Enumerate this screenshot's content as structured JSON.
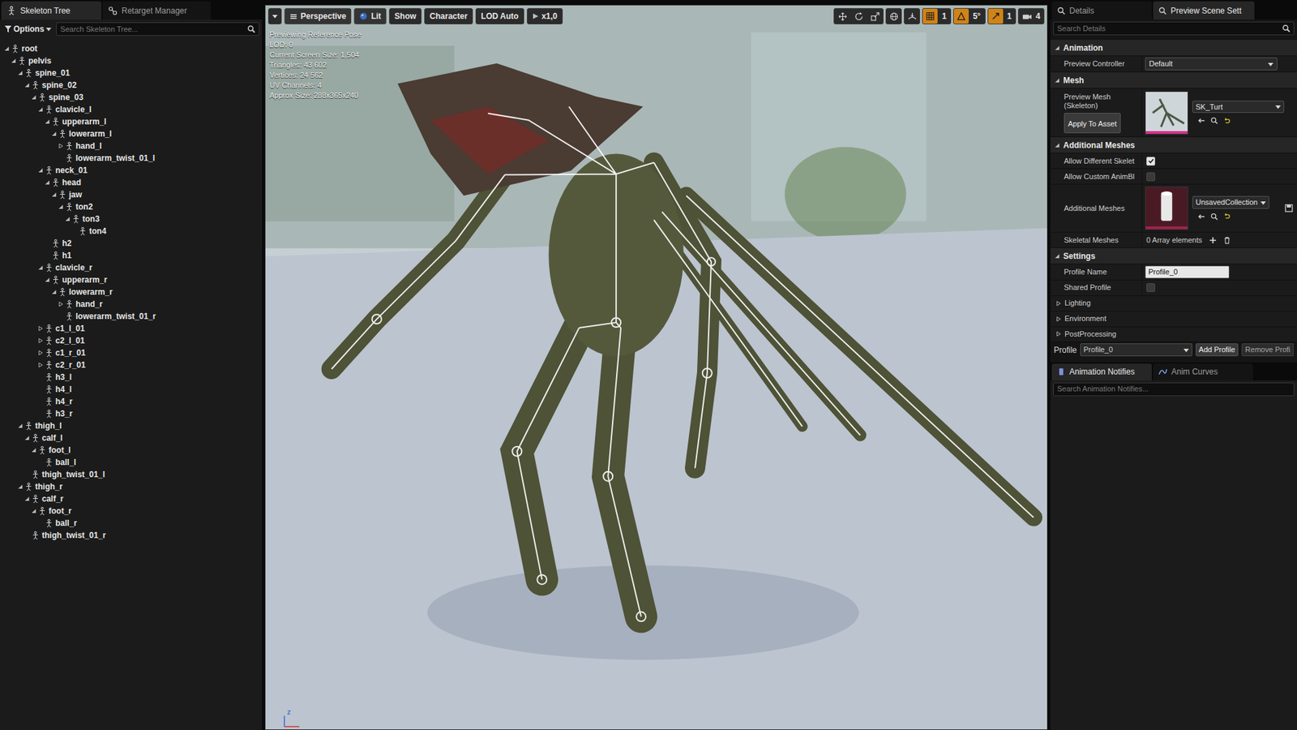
{
  "left_panel": {
    "tabs": [
      {
        "label": "Skeleton Tree",
        "selected": true
      },
      {
        "label": "Retarget Manager",
        "selected": false
      }
    ],
    "options": "Options",
    "search": {
      "placeholder": "Search Skeleton Tree..."
    },
    "tree": [
      {
        "label": "root",
        "kind": "branch",
        "expanded": true,
        "children": [
          {
            "label": "pelvis",
            "kind": "branch",
            "expanded": true,
            "children": [
              {
                "label": "spine_01",
                "kind": "branch",
                "expanded": true,
                "children": [
                  {
                    "label": "spine_02",
                    "kind": "branch",
                    "expanded": true,
                    "children": [
                      {
                        "label": "spine_03",
                        "kind": "branch",
                        "expanded": true,
                        "children": [
                          {
                            "label": "clavicle_l",
                            "kind": "branch",
                            "expanded": true,
                            "children": [
                              {
                                "label": "upperarm_l",
                                "kind": "branch",
                                "expanded": true,
                                "children": [
                                  {
                                    "label": "lowerarm_l",
                                    "kind": "branch",
                                    "expanded": true,
                                    "children": [
                                      {
                                        "label": "hand_l",
                                        "kind": "branch",
                                        "expanded": false
                                      },
                                      {
                                        "label": "lowerarm_twist_01_l",
                                        "kind": "leaf",
                                        "expanded": false
                                      }
                                    ]
                                  }
                                ]
                              }
                            ]
                          },
                          {
                            "label": "neck_01",
                            "kind": "branch",
                            "expanded": true,
                            "children": [
                              {
                                "label": "head",
                                "kind": "branch",
                                "expanded": true,
                                "children": [
                                  {
                                    "label": "jaw",
                                    "kind": "branch",
                                    "expanded": true,
                                    "children": [
                                      {
                                        "label": "ton2",
                                        "kind": "branch",
                                        "expanded": true,
                                        "children": [
                                          {
                                            "label": "ton3",
                                            "kind": "branch",
                                            "expanded": true,
                                            "children": [
                                              {
                                                "label": "ton4",
                                                "kind": "leaf",
                                                "expanded": false
                                              }
                                            ]
                                          }
                                        ]
                                      }
                                    ]
                                  }
                                ]
                              },
                              {
                                "label": "h2",
                                "kind": "leaf",
                                "expanded": false
                              },
                              {
                                "label": "h1",
                                "kind": "leaf",
                                "expanded": false
                              }
                            ]
                          },
                          {
                            "label": "clavicle_r",
                            "kind": "branch",
                            "expanded": true,
                            "children": [
                              {
                                "label": "upperarm_r",
                                "kind": "branch",
                                "expanded": true,
                                "children": [
                                  {
                                    "label": "lowerarm_r",
                                    "kind": "branch",
                                    "expanded": true,
                                    "children": [
                                      {
                                        "label": "hand_r",
                                        "kind": "branch",
                                        "expanded": false
                                      },
                                      {
                                        "label": "lowerarm_twist_01_r",
                                        "kind": "leaf",
                                        "expanded": false
                                      }
                                    ]
                                  }
                                ]
                              }
                            ]
                          },
                          {
                            "label": "c1_l_01",
                            "kind": "branch",
                            "expanded": false
                          },
                          {
                            "label": "c2_l_01",
                            "kind": "branch",
                            "expanded": false
                          },
                          {
                            "label": "c1_r_01",
                            "kind": "branch",
                            "expanded": false
                          },
                          {
                            "label": "c2_r_01",
                            "kind": "branch",
                            "expanded": false
                          },
                          {
                            "label": "h3_l",
                            "kind": "leaf",
                            "expanded": false
                          },
                          {
                            "label": "h4_l",
                            "kind": "leaf",
                            "expanded": false
                          },
                          {
                            "label": "h4_r",
                            "kind": "leaf",
                            "expanded": false
                          },
                          {
                            "label": "h3_r",
                            "kind": "leaf",
                            "expanded": false
                          }
                        ]
                      }
                    ]
                  }
                ]
              },
              {
                "label": "thigh_l",
                "kind": "branch",
                "expanded": true,
                "children": [
                  {
                    "label": "calf_l",
                    "kind": "branch",
                    "expanded": true,
                    "children": [
                      {
                        "label": "foot_l",
                        "kind": "branch",
                        "expanded": true,
                        "children": [
                          {
                            "label": "ball_l",
                            "kind": "leaf",
                            "expanded": false
                          }
                        ]
                      }
                    ]
                  },
                  {
                    "label": "thigh_twist_01_l",
                    "kind": "leaf",
                    "expanded": false
                  }
                ]
              },
              {
                "label": "thigh_r",
                "kind": "branch",
                "expanded": true,
                "children": [
                  {
                    "label": "calf_r",
                    "kind": "branch",
                    "expanded": true,
                    "children": [
                      {
                        "label": "foot_r",
                        "kind": "branch",
                        "expanded": true,
                        "children": [
                          {
                            "label": "ball_r",
                            "kind": "leaf",
                            "expanded": false
                          }
                        ]
                      }
                    ]
                  },
                  {
                    "label": "thigh_twist_01_r",
                    "kind": "leaf",
                    "expanded": false
                  }
                ]
              }
            ]
          }
        ]
      }
    ]
  },
  "viewport": {
    "toolbar": [
      "Perspective",
      "Lit",
      "Show",
      "Character",
      "LOD Auto",
      "x1,0"
    ],
    "snaps": [
      {
        "label": "1",
        "on": true
      },
      {
        "label": "5°",
        "on": true
      },
      {
        "label": "1",
        "on": true
      }
    ],
    "camera_speed": "4",
    "stats": [
      "Previewing Reference Pose",
      "LOD: 0",
      "Current Screen Size: 1,504",
      "Triangles: 43 602",
      "Vertices: 24 562",
      "UV Channels: 4",
      "Approx Size: 288x365x240"
    ],
    "axis": "z"
  },
  "right_panel": {
    "tabs": [
      {
        "label": "Details",
        "selected": false
      },
      {
        "label": "Preview Scene Sett",
        "selected": true
      }
    ],
    "search": {
      "placeholder": "Search Details"
    },
    "sections": [
      {
        "title": "Animation",
        "expanded": true
      },
      {
        "title": "Mesh",
        "expanded": true
      },
      {
        "title": "Additional Meshes",
        "expanded": true
      },
      {
        "title": "Settings",
        "expanded": true
      }
    ],
    "preview_controller": {
      "label": "Preview Controller",
      "value": "Default"
    },
    "preview_mesh": {
      "label": "Preview Mesh (Skeleton)",
      "value": "SK_Turt",
      "button": "Apply To Asset"
    },
    "allow_different_skeletons": {
      "label": "Allow Different Skelet",
      "checked": true
    },
    "allow_custom_anim_bp": {
      "label": "Allow Custom AnimBl",
      "checked": false
    },
    "additional_meshes": {
      "label": "Additional Meshes",
      "value": "UnsavedCollection"
    },
    "skeletal_meshes": {
      "label": "Skeletal Meshes",
      "value": "0 Array elements"
    },
    "profile_name": {
      "label": "Profile Name",
      "value": "Profile_0"
    },
    "shared_profile": {
      "label": "Shared Profile",
      "checked": false
    },
    "subsections": [
      {
        "title": "Lighting",
        "expanded": false
      },
      {
        "title": "Environment",
        "expanded": false
      },
      {
        "title": "PostProcessing",
        "expanded": false
      }
    ],
    "profile_bar": {
      "label": "Profile",
      "value": "Profile_0",
      "add": "Add Profile",
      "remove": "Remove Profi"
    }
  },
  "bottom_panel": {
    "tabs": [
      {
        "label": "Animation Notifies",
        "selected": true
      },
      {
        "label": "Anim Curves",
        "selected": false
      }
    ],
    "search": {
      "placeholder": "Search Animation Notifies..."
    }
  }
}
